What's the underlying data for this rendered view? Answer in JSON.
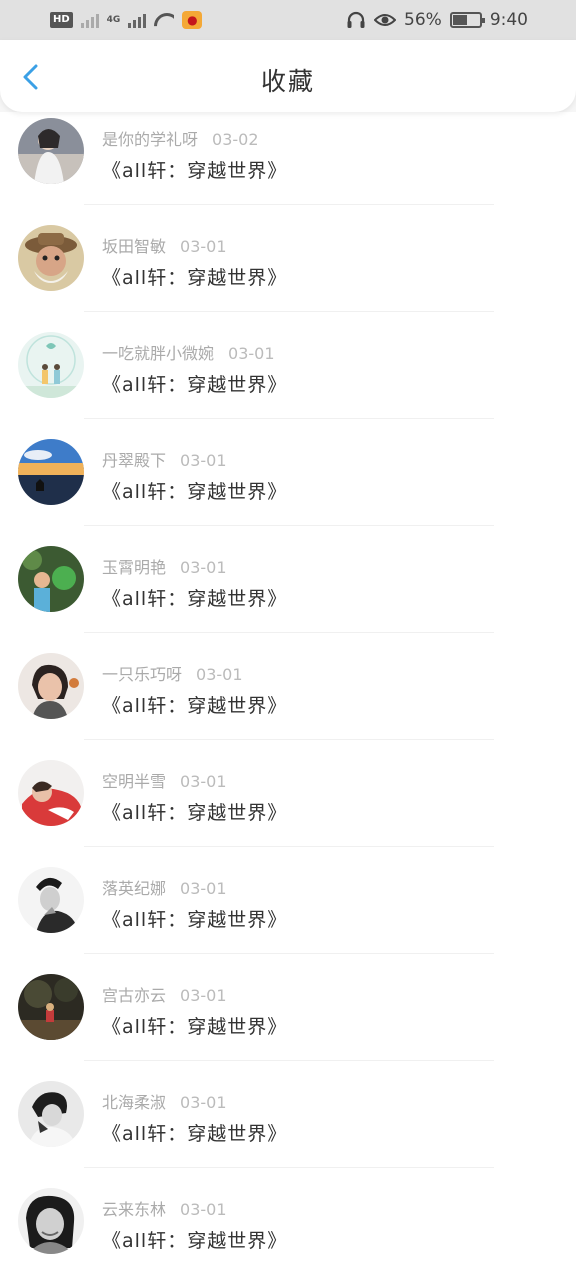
{
  "status_bar": {
    "hd": "HD",
    "net": "4G",
    "battery_percent": "56%",
    "time": "9:40"
  },
  "header": {
    "back_icon": "chevron-left-icon",
    "title": "收藏"
  },
  "colors": {
    "accent": "#3ba0e6",
    "meta_text": "#aaaaaa",
    "title_text": "#333333"
  },
  "favorites": [
    {
      "user": "是你的学礼呀",
      "date": "03-02",
      "book": "《all轩：穿越世界》"
    },
    {
      "user": "坂田智敏",
      "date": "03-01",
      "book": "《all轩：穿越世界》"
    },
    {
      "user": "一吃就胖小微婉",
      "date": "03-01",
      "book": "《all轩：穿越世界》"
    },
    {
      "user": "丹翠殿下",
      "date": "03-01",
      "book": "《all轩：穿越世界》"
    },
    {
      "user": "玉霄明艳",
      "date": "03-01",
      "book": "《all轩：穿越世界》"
    },
    {
      "user": "一只乐巧呀",
      "date": "03-01",
      "book": "《all轩：穿越世界》"
    },
    {
      "user": "空明半雪",
      "date": "03-01",
      "book": "《all轩：穿越世界》"
    },
    {
      "user": "落英纪娜",
      "date": "03-01",
      "book": "《all轩：穿越世界》"
    },
    {
      "user": "宫古亦云",
      "date": "03-01",
      "book": "《all轩：穿越世界》"
    },
    {
      "user": "北海柔淑",
      "date": "03-01",
      "book": "《all轩：穿越世界》"
    },
    {
      "user": "云来东林",
      "date": "03-01",
      "book": "《all轩：穿越世界》"
    }
  ]
}
